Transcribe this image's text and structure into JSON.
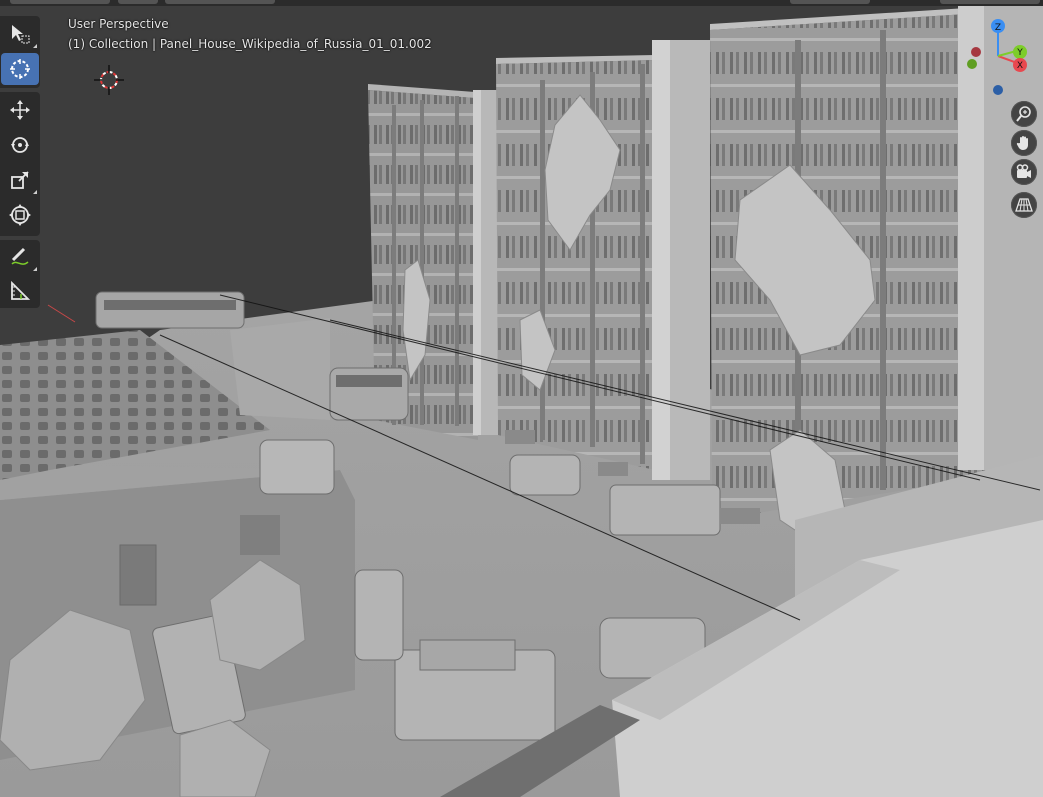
{
  "viewport": {
    "view_name": "User Perspective",
    "collection_info": "(1) Collection | Panel_House_Wikipedia_of_Russia_01_01.002"
  },
  "toolbar": {
    "tools": [
      {
        "id": "select-box",
        "icon": "select-box-icon",
        "active": false
      },
      {
        "id": "cursor",
        "icon": "cursor-icon",
        "active": true
      },
      {
        "id": "move",
        "icon": "move-icon",
        "active": false
      },
      {
        "id": "rotate",
        "icon": "rotate-icon",
        "active": false
      },
      {
        "id": "scale",
        "icon": "scale-icon",
        "active": false
      },
      {
        "id": "transform",
        "icon": "transform-icon",
        "active": false
      },
      {
        "id": "annotate",
        "icon": "annotate-icon",
        "active": false
      },
      {
        "id": "measure",
        "icon": "measure-icon",
        "active": false
      }
    ]
  },
  "navigation": {
    "gizmo": {
      "x_label": "X",
      "y_label": "Y",
      "z_label": "Z",
      "x_color": "#e8484f",
      "y_color": "#7dcd2a",
      "z_color": "#3a8ef2",
      "neg_x_color": "#a63840",
      "neg_y_color": "#5f9e22",
      "neg_z_color": "#2c5fa6"
    },
    "buttons": [
      "zoom-icon",
      "pan-hand-icon",
      "camera-icon",
      "perspective-grid-icon"
    ]
  },
  "colors": {
    "active_tool": "#4772b3",
    "toolbar_bg": "#2b2b2b",
    "viewport_bg": "#3d3d3d",
    "model_gray": "#a9a9a9"
  }
}
